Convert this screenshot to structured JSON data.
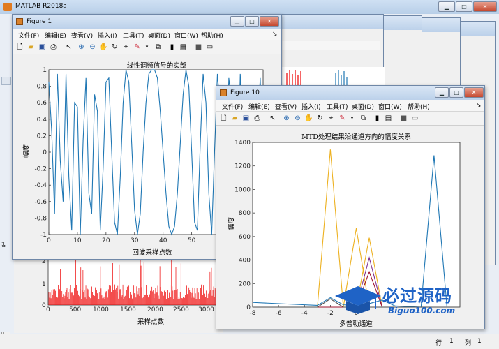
{
  "main_window": {
    "title": "MATLAB R2018a",
    "buttons": [
      "▁",
      "□",
      "✕"
    ],
    "status_row_label": "行",
    "status_row_value": "1",
    "status_col_label": "列",
    "status_col_value": "1"
  },
  "figure1": {
    "title": "Figure 1",
    "menu": [
      "文件(F)",
      "编辑(E)",
      "查看(V)",
      "插入(I)",
      "工具(T)",
      "桌面(D)",
      "窗口(W)",
      "帮助(H)"
    ],
    "axes_title": "线性调频信号的实部",
    "xlabel": "回波采样点数",
    "ylabel": "幅度",
    "xticks": [
      "0",
      "10",
      "20",
      "30",
      "40",
      "50",
      "60",
      "70"
    ],
    "yticks": [
      "1",
      "0.8",
      "0.6",
      "0.4",
      "0.2",
      "0",
      "-0.2",
      "-0.4",
      "-0.6",
      "-0.8",
      "-1"
    ]
  },
  "lower_plot": {
    "xlabel": "采样点数",
    "xticks": [
      "0",
      "500",
      "1000",
      "1500",
      "2000",
      "2500",
      "3000"
    ],
    "yticks": [
      "2",
      "1",
      "0"
    ]
  },
  "figure10": {
    "title": "Figure 10",
    "menu": [
      "文件(F)",
      "编辑(E)",
      "查看(V)",
      "插入(I)",
      "工具(T)",
      "桌面(D)",
      "窗口(W)",
      "帮助(H)"
    ],
    "axes_title": "MTD处理结果沿通道方向的幅度关系",
    "xlabel": "多普勒通道",
    "ylabel": "幅度",
    "xticks": [
      "-8",
      "-6",
      "-4",
      "-2",
      "0"
    ],
    "yticks": [
      "1400",
      "1200",
      "1000",
      "800",
      "600",
      "400",
      "200",
      "0"
    ]
  },
  "watermark": {
    "brand": "必过源码",
    "url": "Biguo100.com"
  },
  "chart_data": [
    {
      "type": "line",
      "title": "线性调频信号的实部",
      "xlabel": "回波采样点数",
      "ylabel": "幅度",
      "xlim": [
        0,
        75
      ],
      "ylim": [
        -1,
        1
      ],
      "series": [
        {
          "color": "#1f77b4",
          "x": [
            0,
            1,
            2,
            3,
            4,
            5,
            6,
            7,
            8,
            9,
            10,
            11,
            12,
            13,
            14,
            15,
            16,
            17,
            18,
            19,
            20,
            21,
            22,
            23,
            24,
            25,
            26,
            27,
            28,
            29,
            30,
            31,
            32,
            33,
            34,
            35,
            36,
            37,
            38,
            39,
            40,
            41,
            42,
            43,
            44,
            45,
            46,
            47,
            48,
            49,
            50,
            51,
            52,
            53,
            54,
            55,
            56,
            57,
            58,
            59,
            60,
            61,
            62,
            63,
            64,
            65,
            66,
            67,
            68,
            69,
            70,
            71,
            72,
            73,
            74,
            75
          ],
          "y": [
            0.85,
            0.25,
            -0.75,
            0.95,
            -0.1,
            -0.6,
            0.95,
            -0.3,
            -0.95,
            0.6,
            0.55,
            -1,
            0.15,
            0.9,
            -0.5,
            -0.75,
            0.7,
            0.5,
            -0.95,
            -0.2,
            0.85,
            0.9,
            0.0,
            -0.85,
            -1,
            -0.3,
            0.6,
            1,
            0.85,
            0.1,
            -0.7,
            -1,
            -0.75,
            0.0,
            0.6,
            0.95,
            1,
            1,
            0.9,
            0.5,
            0.0,
            -0.5,
            -0.9,
            -1,
            -0.9,
            -0.5,
            0.1,
            0.7,
            1,
            0.8,
            0.0,
            -0.85,
            -0.95,
            0.1,
            0.95,
            0.6,
            -0.5,
            -1,
            0.0,
            0.95,
            0.5,
            -0.9,
            -0.4,
            0.9,
            0.6,
            -0.8,
            -0.6,
            0.95,
            0.2,
            -1,
            0.6,
            0.8,
            -0.9,
            0.3,
            0.9,
            -0.5
          ]
        }
      ]
    },
    {
      "type": "line",
      "title": "MTD处理结果沿通道方向的幅度关系",
      "xlabel": "多普勒通道",
      "ylabel": "幅度",
      "xlim": [
        -8,
        8
      ],
      "ylim": [
        0,
        1400
      ],
      "series": [
        {
          "color": "#edb120",
          "x": [
            -8,
            -3,
            -2,
            -1,
            0,
            1,
            8
          ],
          "y": [
            0,
            0,
            1340,
            0,
            0,
            0,
            0
          ]
        },
        {
          "color": "#edb120",
          "x": [
            -8,
            -1,
            0,
            1,
            8
          ],
          "y": [
            0,
            0,
            670,
            0,
            0
          ]
        },
        {
          "color": "#edb120",
          "x": [
            -8,
            0,
            1,
            2,
            8
          ],
          "y": [
            0,
            0,
            590,
            0,
            0
          ]
        },
        {
          "color": "#7e2f8e",
          "x": [
            -8,
            0,
            1,
            2,
            8
          ],
          "y": [
            0,
            0,
            420,
            0,
            0
          ]
        },
        {
          "color": "#a2142f",
          "x": [
            -8,
            0,
            1,
            2,
            8
          ],
          "y": [
            0,
            0,
            300,
            0,
            0
          ]
        },
        {
          "color": "#1f77b4",
          "x": [
            -8,
            -4,
            -3,
            -2,
            -1,
            0,
            1,
            2,
            3,
            4,
            5,
            6,
            7,
            8
          ],
          "y": [
            40,
            20,
            15,
            80,
            20,
            15,
            30,
            60,
            10,
            5,
            0,
            1290,
            0,
            0
          ]
        },
        {
          "color": "#4d4d4d",
          "x": [
            -8,
            -3,
            -2,
            -1,
            0,
            1,
            8
          ],
          "y": [
            0,
            0,
            70,
            0,
            0,
            0,
            0
          ]
        }
      ]
    }
  ]
}
